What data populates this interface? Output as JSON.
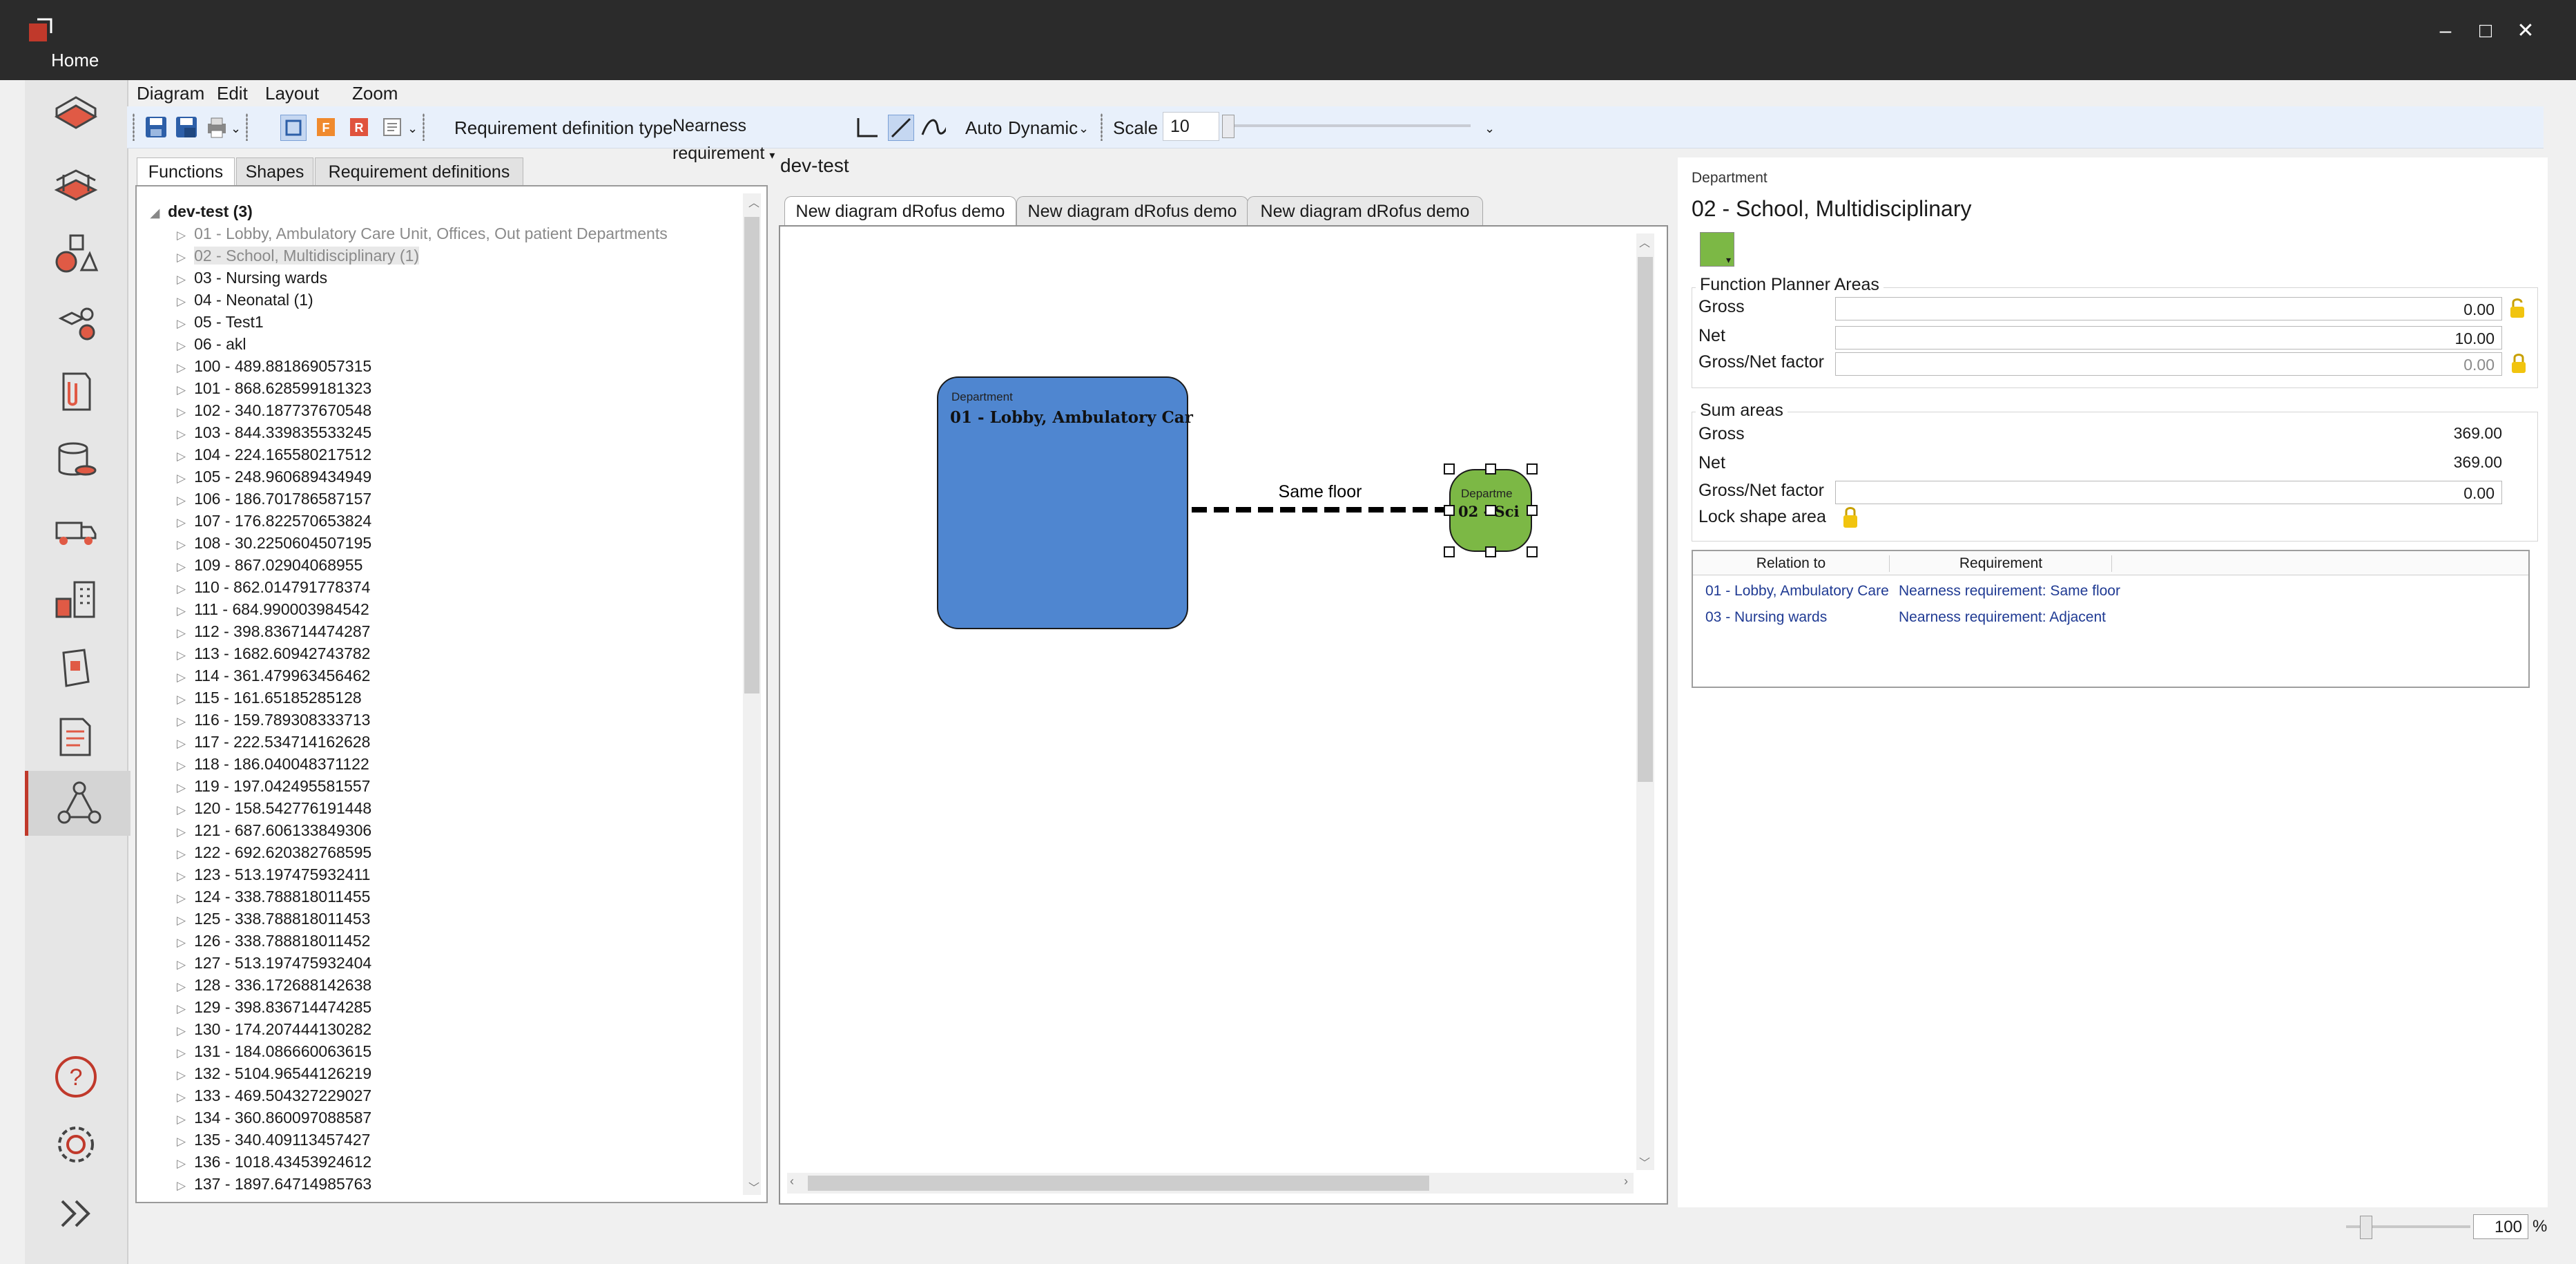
{
  "app": {
    "home_tab": "Home"
  },
  "window_controls": {
    "minimize": "–",
    "maximize": "□",
    "close": "✕"
  },
  "menu": [
    "Diagram",
    "Edit",
    "Layout",
    "Zoom"
  ],
  "toolbar": {
    "req_type_label": "Requirement definition type",
    "req_type_value": "Nearness requirement",
    "auto_label": "Auto",
    "dynamic_label": "Dynamic",
    "scale_label": "Scale",
    "scale_value": "10",
    "scale_slider_fraction": 0.0
  },
  "left_panel": {
    "tabs": [
      "Functions",
      "Shapes",
      "Requirement definitions"
    ],
    "active_tab": 0,
    "root": "dev-test  (3)",
    "items": [
      {
        "label": "01 - Lobby, Ambulatory Care Unit, Offices, Out patient Departments",
        "grey": true
      },
      {
        "label": "02 - School, Multidisciplinary  (1)",
        "grey": true,
        "selected": true
      },
      {
        "label": "03 - Nursing wards"
      },
      {
        "label": "04 - Neonatal  (1)"
      },
      {
        "label": "05 - Test1"
      },
      {
        "label": "06 - akl"
      },
      {
        "label": "100 - 489.881869057315"
      },
      {
        "label": "101 - 868.628599181323"
      },
      {
        "label": "102 - 340.187737670548"
      },
      {
        "label": "103 - 844.339835533245"
      },
      {
        "label": "104 - 224.165580217512"
      },
      {
        "label": "105 - 248.960689434949"
      },
      {
        "label": "106 - 186.701786587157"
      },
      {
        "label": "107 - 176.822570653824"
      },
      {
        "label": "108 - 30.2250604507195"
      },
      {
        "label": "109 - 867.02904068955"
      },
      {
        "label": "110 - 862.014791778374"
      },
      {
        "label": "111 - 684.990003984542"
      },
      {
        "label": "112 - 398.836714474287"
      },
      {
        "label": "113 - 1682.60942743782"
      },
      {
        "label": "114 - 361.479963456462"
      },
      {
        "label": "115 - 161.65185285128"
      },
      {
        "label": "116 - 159.789308333713"
      },
      {
        "label": "117 - 222.534714162628"
      },
      {
        "label": "118 - 186.040048371122"
      },
      {
        "label": "119 - 197.042495581557"
      },
      {
        "label": "120 - 158.542776191448"
      },
      {
        "label": "121 - 687.606133849306"
      },
      {
        "label": "122 - 692.620382768595"
      },
      {
        "label": "123 - 513.197475932411"
      },
      {
        "label": "124 - 338.788818011455"
      },
      {
        "label": "125 - 338.788818011453"
      },
      {
        "label": "126 - 338.788818011452"
      },
      {
        "label": "127 - 513.197475932404"
      },
      {
        "label": "128 - 336.172688142638"
      },
      {
        "label": "129 - 398.836714474285"
      },
      {
        "label": "130 - 174.207444130282"
      },
      {
        "label": "131 - 184.086660063615"
      },
      {
        "label": "132 - 5104.96544126219"
      },
      {
        "label": "133 - 469.504327229027"
      },
      {
        "label": "134 - 360.860097088587"
      },
      {
        "label": "135 - 340.409113457427"
      },
      {
        "label": "136 - 1018.43453924612"
      },
      {
        "label": "137 - 1897.64714985763"
      }
    ]
  },
  "diagram": {
    "title": "dev-test",
    "tabs": [
      "New diagram dRofus demo",
      "New diagram dRofus demo",
      "New diagram dRofus demo"
    ],
    "active_tab": 0,
    "node1": {
      "caption": "Department",
      "name": "01 - Lobby, Ambulatory Car",
      "color": "#4f86d0"
    },
    "node2": {
      "caption": "Departme",
      "name": "02 - Sci",
      "color": "#7cb845"
    },
    "edge_label": "Same floor"
  },
  "right_panel": {
    "caption": "Department",
    "title": "02 - School, Multidisciplinary",
    "swatch_color": "#7cb845",
    "planner_group": "Function Planner Areas",
    "gross_label": "Gross",
    "gross_value": "0.00",
    "net_label": "Net",
    "net_value": "10.00",
    "factor_label": "Gross/Net factor",
    "factor_value": "0.00",
    "sum_group": "Sum areas",
    "sum_gross_label": "Gross",
    "sum_gross_value": "369.00",
    "sum_net_label": "Net",
    "sum_net_value": "369.00",
    "sum_factor_label": "Gross/Net factor",
    "sum_factor_value": "0.00",
    "lock_label": "Lock shape area",
    "relations": {
      "headers": [
        "Relation to",
        "Requirement"
      ],
      "rows": [
        [
          "01 - Lobby, Ambulatory Care",
          "Nearness requirement: Same floor"
        ],
        [
          "03 - Nursing wards",
          "Nearness requirement: Adjacent"
        ]
      ]
    }
  },
  "status": {
    "zoom_value": "100",
    "zoom_unit": "%"
  },
  "colors": {
    "accent": "#c0392b",
    "titlebar": "#2b2b2b"
  }
}
